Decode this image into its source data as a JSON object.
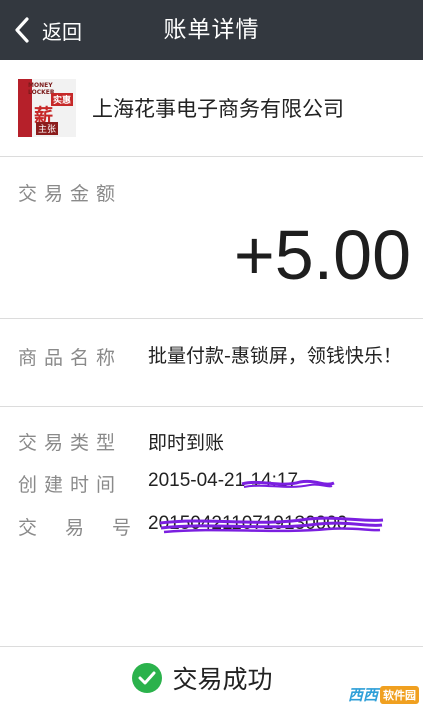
{
  "header": {
    "back_label": "返回",
    "title": "账单详情"
  },
  "merchant": {
    "logo_small_text": "MONEY LOCKER",
    "logo_tag": "实惠",
    "logo_big": "薪",
    "logo_bottom": "主张",
    "name": "上海花事电子商务有限公司"
  },
  "amount": {
    "label": "交易金额",
    "value": "+5.00"
  },
  "product": {
    "label": "商品名称",
    "value": "批量付款-惠锁屏，领钱快乐！"
  },
  "details": {
    "type_label": "交易类型",
    "type_value": "即时到账",
    "time_label": "创建时间",
    "time_value": "2015-04-21 14:17",
    "id_label": "交易号",
    "id_value": "2015042110719130000"
  },
  "footer": {
    "status": "交易成功",
    "watermark": "西西",
    "watermark_text": "软件园"
  },
  "colors": {
    "header_bg": "#33383f",
    "success_green": "#2bb24c",
    "redaction_purple": "#7b1fe0"
  }
}
